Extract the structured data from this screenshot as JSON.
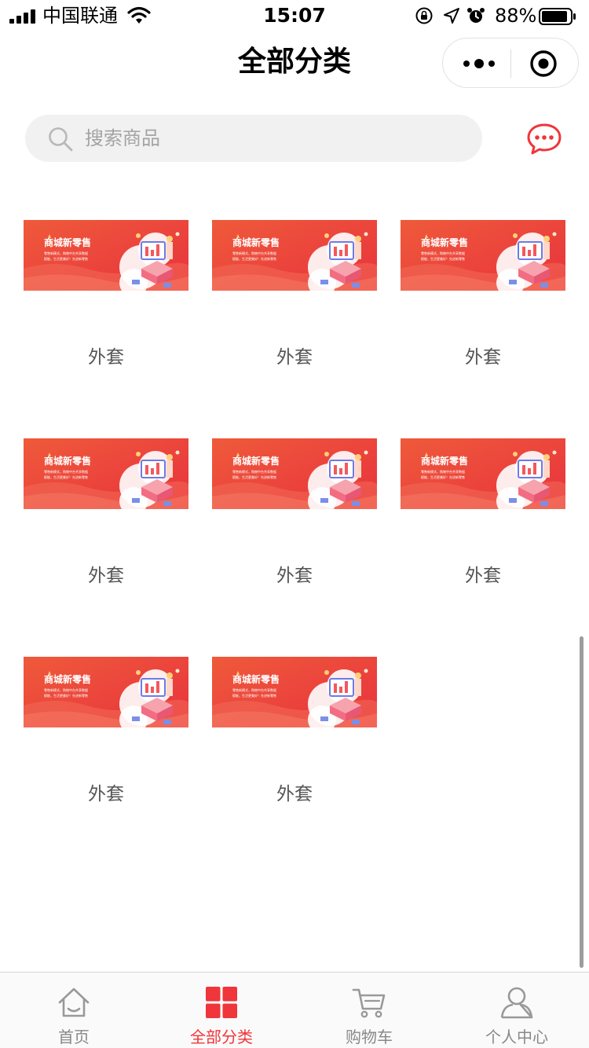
{
  "status_bar": {
    "carrier": "中国联通",
    "time": "15:07",
    "battery": "88%",
    "icons": [
      "signal-icon",
      "wifi-icon",
      "orientation-lock-icon",
      "location-icon",
      "alarm-icon",
      "battery-icon"
    ]
  },
  "nav": {
    "title": "全部分类",
    "capsule_icons": [
      "more-icon",
      "target-icon"
    ]
  },
  "search": {
    "placeholder": "搜索商品",
    "icon": "search-icon",
    "chat_icon": "chat-bubble-icon"
  },
  "banner": {
    "headline": "商城新零售",
    "line1": "零售新模式，购物中台共享数据",
    "line2": "赋能，生活更美好！先进新零售"
  },
  "categories": [
    {
      "label": "外套"
    },
    {
      "label": "外套"
    },
    {
      "label": "外套"
    },
    {
      "label": "外套"
    },
    {
      "label": "外套"
    },
    {
      "label": "外套"
    },
    {
      "label": "外套"
    },
    {
      "label": "外套"
    }
  ],
  "tabbar": {
    "tabs": [
      {
        "label": "首页",
        "icon": "home-icon",
        "active": false
      },
      {
        "label": "全部分类",
        "icon": "grid-icon",
        "active": true
      },
      {
        "label": "购物车",
        "icon": "cart-icon",
        "active": false
      },
      {
        "label": "个人中心",
        "icon": "user-icon",
        "active": false
      }
    ]
  },
  "colors": {
    "accent": "#f0353b",
    "banner": "#ef4b3a"
  }
}
